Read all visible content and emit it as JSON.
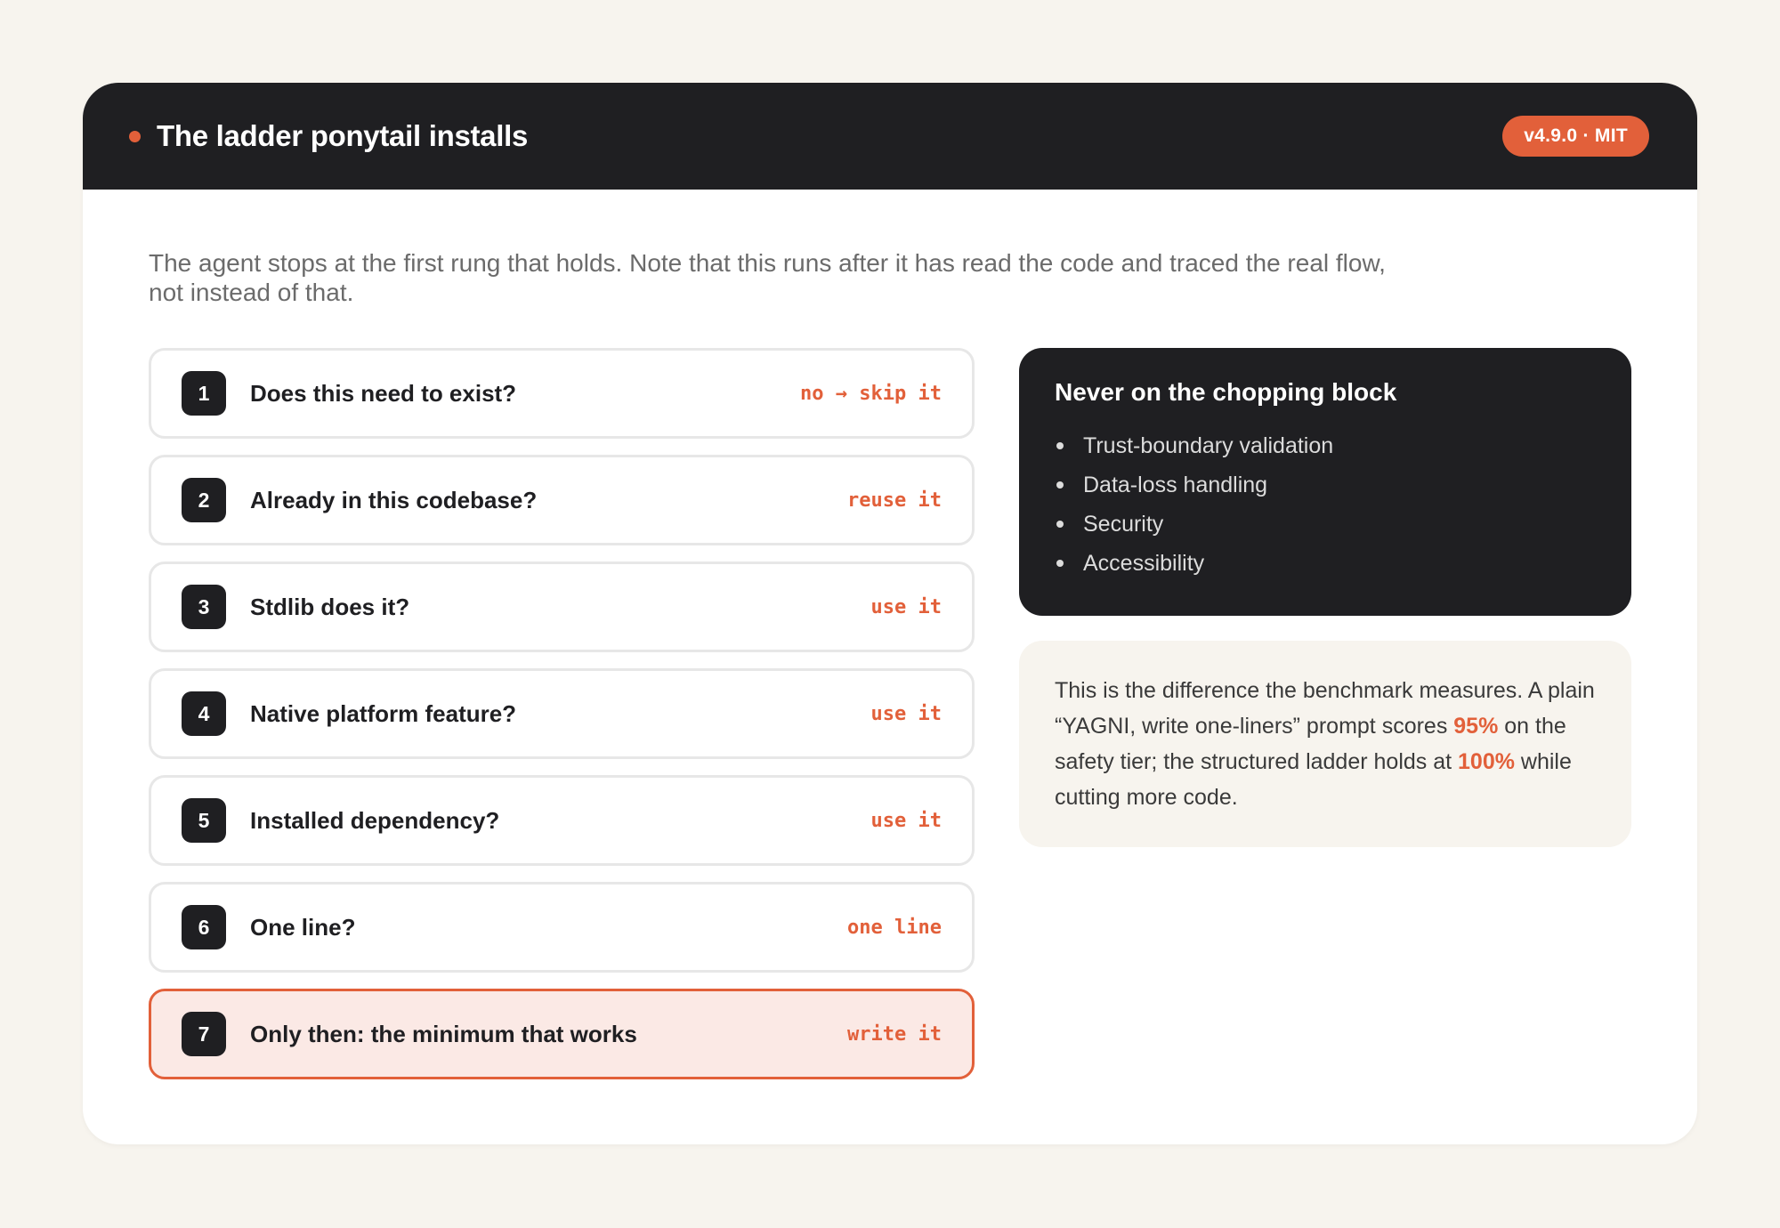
{
  "header": {
    "title": "The ladder ponytail installs",
    "badge": "v4.9.0 · MIT"
  },
  "intro": "The agent stops at the first rung that holds. Note that this runs after it has read the code and traced the real flow, not instead of that.",
  "ladder": [
    {
      "num": "1",
      "question": "Does this need to exist?",
      "action": "no → skip it"
    },
    {
      "num": "2",
      "question": "Already in this codebase?",
      "action": "reuse it"
    },
    {
      "num": "3",
      "question": "Stdlib does it?",
      "action": "use it"
    },
    {
      "num": "4",
      "question": "Native platform feature?",
      "action": "use it"
    },
    {
      "num": "5",
      "question": "Installed dependency?",
      "action": "use it"
    },
    {
      "num": "6",
      "question": "One line?",
      "action": "one line"
    },
    {
      "num": "7",
      "question": "Only then: the minimum that works",
      "action": "write it"
    }
  ],
  "never": {
    "title": "Never on the chopping block",
    "items": [
      "Trust-boundary validation",
      "Data-loss handling",
      "Security",
      "Accessibility"
    ]
  },
  "note": {
    "part1": "This is the difference the benchmark measures. A plain “YAGNI, write one-liners” prompt scores ",
    "highlight1": "95%",
    "part2": " on the safety tier; the structured ladder holds at ",
    "highlight2": "100%",
    "part3": " while cutting more code."
  },
  "colors": {
    "accent": "#e2603a",
    "dark": "#1f1f22",
    "background": "#f7f4ee",
    "final_rung_fill": "#fbe9e5"
  }
}
